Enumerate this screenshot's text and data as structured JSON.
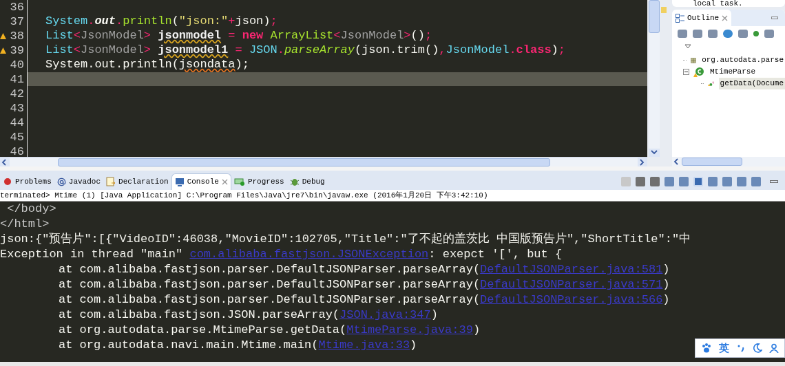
{
  "editor": {
    "lines": [
      {
        "number": "36"
      },
      {
        "number": "37",
        "tokens": [
          {
            "kind": "type",
            "text": "System"
          },
          {
            "kind": "op",
            "text": "."
          },
          {
            "kind": "field",
            "text": "out"
          },
          {
            "kind": "op",
            "text": "."
          },
          {
            "kind": "method",
            "text": "println"
          },
          {
            "kind": "plain",
            "text": "("
          },
          {
            "kind": "string",
            "text": "\"json:\""
          },
          {
            "kind": "op",
            "text": "+"
          },
          {
            "kind": "plain",
            "text": "json)"
          },
          {
            "kind": "op",
            "text": ";"
          }
        ]
      },
      {
        "number": "38",
        "warning": true,
        "tokens": [
          {
            "kind": "type",
            "text": "List"
          },
          {
            "kind": "op",
            "text": "<"
          },
          {
            "kind": "generic",
            "text": "JsonModel"
          },
          {
            "kind": "op",
            "text": "> "
          },
          {
            "kind": "warnvar",
            "text": "jsonmodel"
          },
          {
            "kind": "op",
            "text": " = "
          },
          {
            "kind": "keyword",
            "text": "new"
          },
          {
            "kind": "method",
            "text": " ArrayList"
          },
          {
            "kind": "op",
            "text": "<"
          },
          {
            "kind": "generic",
            "text": "JsonModel"
          },
          {
            "kind": "op",
            "text": ">"
          },
          {
            "kind": "plain",
            "text": "()"
          },
          {
            "kind": "op",
            "text": ";"
          }
        ]
      },
      {
        "number": "39",
        "warning": true,
        "tokens": [
          {
            "kind": "type",
            "text": "List"
          },
          {
            "kind": "op",
            "text": "<"
          },
          {
            "kind": "generic",
            "text": "JsonModel"
          },
          {
            "kind": "op",
            "text": "> "
          },
          {
            "kind": "warnvar",
            "text": "jsonmodel1"
          },
          {
            "kind": "op",
            "text": " = "
          },
          {
            "kind": "type",
            "text": "JSON"
          },
          {
            "kind": "op",
            "text": "."
          },
          {
            "kind": "static",
            "text": "parseArray"
          },
          {
            "kind": "plain",
            "text": "(json.trim()"
          },
          {
            "kind": "op",
            "text": ","
          },
          {
            "kind": "type",
            "text": "JsonModel"
          },
          {
            "kind": "op",
            "text": "."
          },
          {
            "kind": "keyword",
            "text": "class"
          },
          {
            "kind": "plain",
            "text": ")"
          },
          {
            "kind": "op",
            "text": ";"
          }
        ]
      },
      {
        "number": "40",
        "tokens": [
          {
            "kind": "plain",
            "text": "System.out.println("
          },
          {
            "kind": "errvar",
            "text": "jsondata"
          },
          {
            "kind": "plain",
            "text": ");"
          }
        ]
      },
      {
        "number": "41",
        "current": true
      },
      {
        "number": "42"
      },
      {
        "number": "43"
      },
      {
        "number": "44"
      },
      {
        "number": "45"
      },
      {
        "number": "46"
      }
    ]
  },
  "outline": {
    "top_text": "local task.",
    "tab": "Outline",
    "tree": [
      {
        "label": "org.autodata.parse",
        "kind": "import",
        "selected": false
      },
      {
        "label": "MtimeParse",
        "kind": "class",
        "expanded": true,
        "selected": false,
        "children": [
          {
            "label": "getData(Docume",
            "kind": "method",
            "selected": true
          }
        ]
      }
    ]
  },
  "bottom_tabs": [
    {
      "label": "Problems",
      "selected": false
    },
    {
      "label": "Javadoc",
      "selected": false
    },
    {
      "label": "Declaration",
      "selected": false
    },
    {
      "label": "Console",
      "selected": true
    },
    {
      "label": "Progress",
      "selected": false
    },
    {
      "label": "Debug",
      "selected": false
    }
  ],
  "console": {
    "status": "terminated> Mtime (1) [Java Application] C:\\Program Files\\Java\\jre7\\bin\\javaw.exe (2016年1月20日 下午3:42:10)",
    "lines": [
      {
        "kind": "markup",
        "segments": [
          {
            "text": " </body>",
            "link": false
          }
        ]
      },
      {
        "kind": "markup",
        "segments": [
          {
            "text": "</html>",
            "link": false
          }
        ]
      },
      {
        "kind": "plain",
        "segments": [
          {
            "text": "json:{\"预告片\":[{\"VideoID\":46038,\"MovieID\":102705,\"Title\":\"了不起的盖茨比 中国版预告片\",\"ShortTitle\":\"中",
            "link": false
          }
        ]
      },
      {
        "kind": "plain",
        "segments": [
          {
            "text": "Exception in thread \"main\" ",
            "link": false
          },
          {
            "text": "com.alibaba.fastjson.JSONException",
            "link": true
          },
          {
            "text": ": exepct '[', but {",
            "link": false
          }
        ]
      },
      {
        "kind": "stack",
        "segments": [
          {
            "text": "at com.alibaba.fastjson.parser.DefaultJSONParser.parseArray(",
            "link": false
          },
          {
            "text": "DefaultJSONParser.java:581",
            "link": true
          },
          {
            "text": ")",
            "link": false
          }
        ]
      },
      {
        "kind": "stack",
        "segments": [
          {
            "text": "at com.alibaba.fastjson.parser.DefaultJSONParser.parseArray(",
            "link": false
          },
          {
            "text": "DefaultJSONParser.java:571",
            "link": true
          },
          {
            "text": ")",
            "link": false
          }
        ]
      },
      {
        "kind": "stack",
        "segments": [
          {
            "text": "at com.alibaba.fastjson.parser.DefaultJSONParser.parseArray(",
            "link": false
          },
          {
            "text": "DefaultJSONParser.java:566",
            "link": true
          },
          {
            "text": ")",
            "link": false
          }
        ]
      },
      {
        "kind": "stack",
        "segments": [
          {
            "text": "at com.alibaba.fastjson.JSON.parseArray(",
            "link": false
          },
          {
            "text": "JSON.java:347",
            "link": true
          },
          {
            "text": ")",
            "link": false
          }
        ]
      },
      {
        "kind": "stack",
        "segments": [
          {
            "text": "at org.autodata.parse.MtimeParse.getData(",
            "link": false
          },
          {
            "text": "MtimeParse.java:39",
            "link": true
          },
          {
            "text": ")",
            "link": false
          }
        ]
      },
      {
        "kind": "stack",
        "segments": [
          {
            "text": "at org.autodata.navi.main.Mtime.main(",
            "link": false
          },
          {
            "text": "Mtime.java:33",
            "link": true
          },
          {
            "text": ")",
            "link": false
          }
        ]
      }
    ]
  },
  "ime": {
    "mode": "英"
  }
}
